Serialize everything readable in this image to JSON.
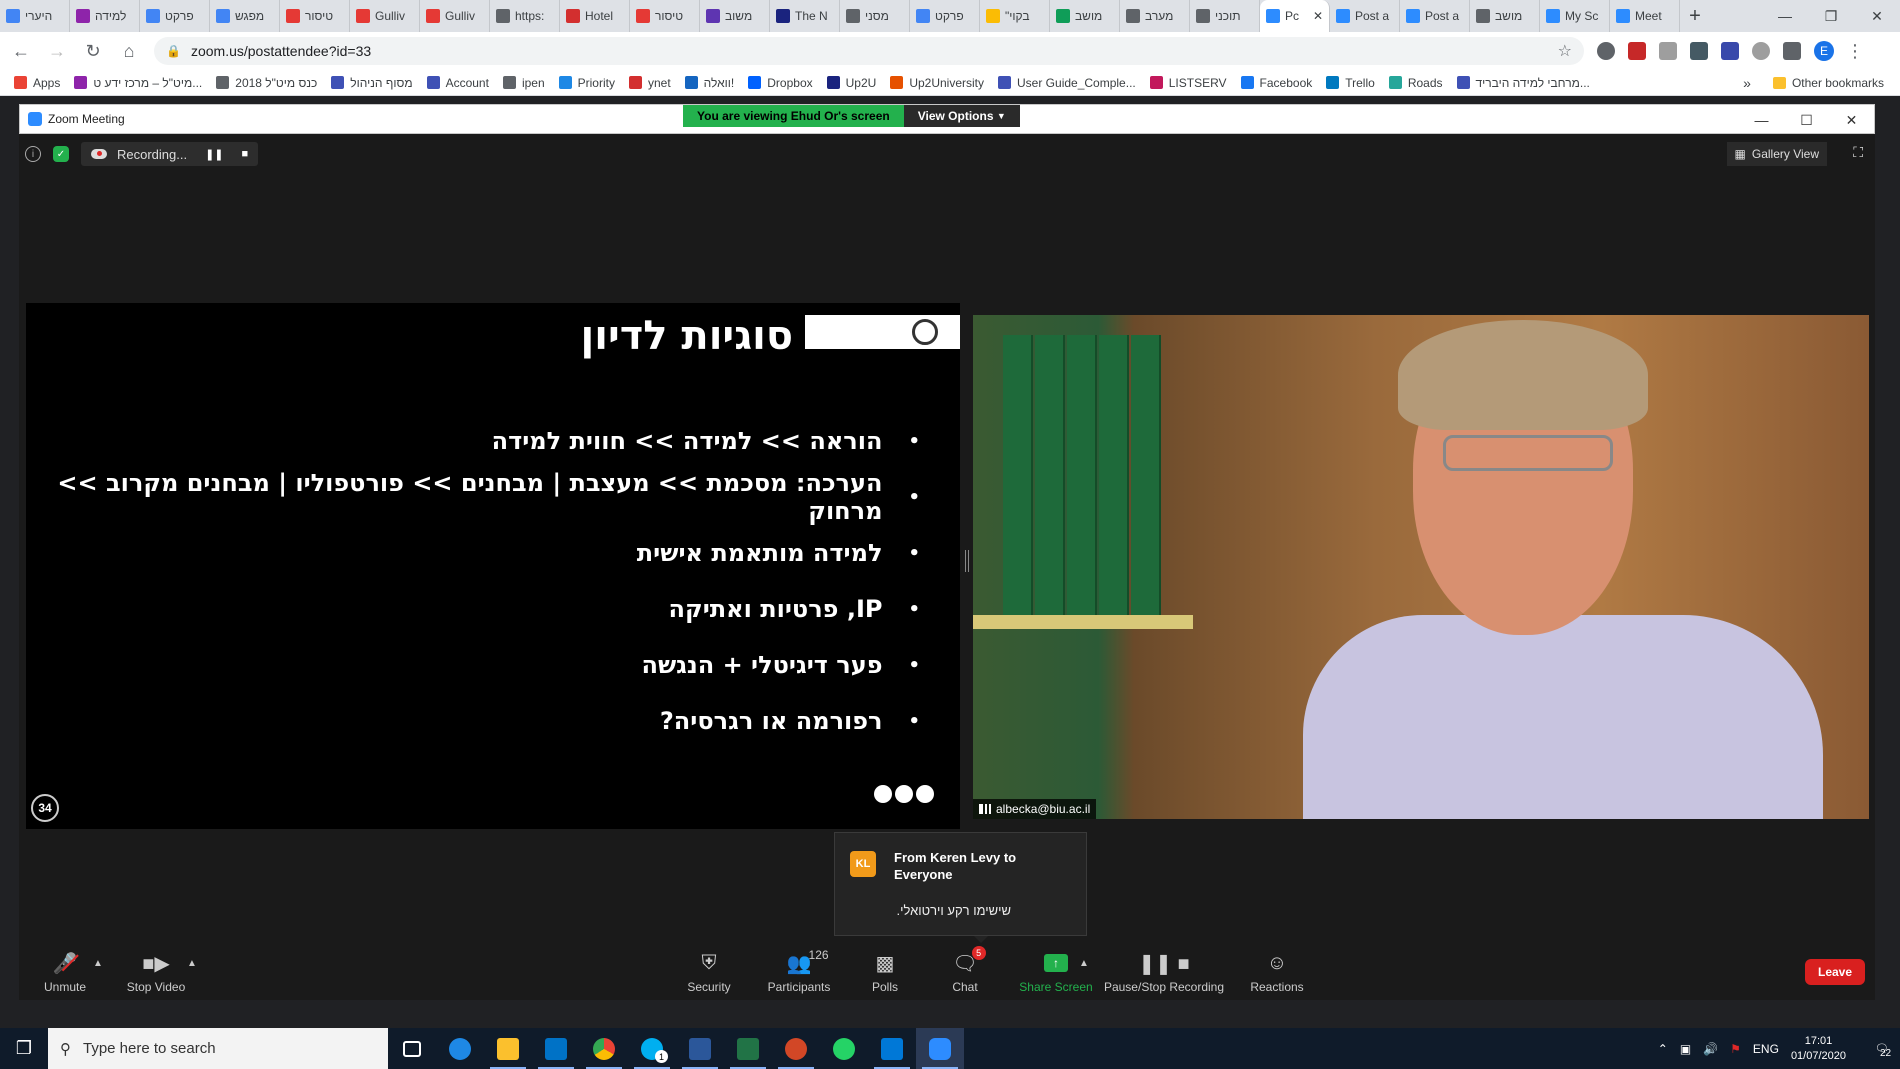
{
  "browser": {
    "tabs": [
      {
        "label": "היערי",
        "color": "#4285f4"
      },
      {
        "label": "למידה",
        "color": "#8e24aa"
      },
      {
        "label": "פרקט",
        "color": "#4285f4"
      },
      {
        "label": "מפגש",
        "color": "#4285f4"
      },
      {
        "label": "טיסור",
        "color": "#e53935"
      },
      {
        "label": "Gulliv",
        "color": "#e53935"
      },
      {
        "label": "Gulliv",
        "color": "#e53935"
      },
      {
        "label": "https:",
        "color": "#5f6368"
      },
      {
        "label": "Hotel",
        "color": "#d32f2f"
      },
      {
        "label": "טיסור",
        "color": "#e53935"
      },
      {
        "label": "משוב",
        "color": "#5e35b1"
      },
      {
        "label": "The N",
        "color": "#1a237e"
      },
      {
        "label": "מסני",
        "color": "#5f6368"
      },
      {
        "label": "פרקט",
        "color": "#4285f4"
      },
      {
        "label": "\"בקוי",
        "color": "#fbbc04"
      },
      {
        "label": "מושב",
        "color": "#0f9d58"
      },
      {
        "label": "מערב",
        "color": "#5f6368"
      },
      {
        "label": "תוכני",
        "color": "#5f6368"
      },
      {
        "label": "Pc",
        "color": "#2d8cff",
        "active": true
      },
      {
        "label": "Post a",
        "color": "#2d8cff"
      },
      {
        "label": "Post a",
        "color": "#2d8cff"
      },
      {
        "label": "מושב",
        "color": "#5f6368"
      },
      {
        "label": "My Sc",
        "color": "#2d8cff"
      },
      {
        "label": "Meet",
        "color": "#2d8cff"
      }
    ],
    "new_tab": "+",
    "url": "zoom.us/postattendee?id=33",
    "profile_initial": "E",
    "bookmarks": [
      {
        "label": "Apps",
        "color": "#ea4335"
      },
      {
        "label": "מיט\"ל – מרכז ידע ט...",
        "color": "#8e24aa"
      },
      {
        "label": "כנס מיט\"ל 2018",
        "color": "#5f6368"
      },
      {
        "label": "מסוף הניהול",
        "color": "#3f51b5"
      },
      {
        "label": "Account",
        "color": "#3f51b5"
      },
      {
        "label": "ipen",
        "color": "#5f6368"
      },
      {
        "label": "Priority",
        "color": "#1e88e5"
      },
      {
        "label": "ynet",
        "color": "#d32f2f"
      },
      {
        "label": "וואלה!",
        "color": "#1565c0"
      },
      {
        "label": "Dropbox",
        "color": "#0061fe"
      },
      {
        "label": "Up2U",
        "color": "#1a237e"
      },
      {
        "label": "Up2University",
        "color": "#e65100"
      },
      {
        "label": "User Guide_Comple...",
        "color": "#3f51b5"
      },
      {
        "label": "LISTSERV",
        "color": "#c2185b"
      },
      {
        "label": "Facebook",
        "color": "#1877f2"
      },
      {
        "label": "Trello",
        "color": "#0079bf"
      },
      {
        "label": "Roads",
        "color": "#26a69a"
      },
      {
        "label": "מרחבי למידה היבריד...",
        "color": "#3f51b5"
      }
    ],
    "bookmarks_more": "»",
    "other_bookmarks": "Other bookmarks"
  },
  "zoom": {
    "window_title": "Zoom Meeting",
    "viewing_banner": "You are viewing Ehud Or's screen",
    "view_options": "View Options",
    "recording_status": "Recording...",
    "gallery_view": "Gallery View",
    "slide": {
      "title": "סוגיות לדיון",
      "bullets": [
        "הוראה >> למידה >> חווית למידה",
        "הערכה: מסכמת >> מעצבת | מבחנים >> פורטפוליו | מבחנים מקרוב >> מרחוק",
        "למידה מותאמת אישית",
        "IP, פרטיות ואתיקה",
        "פער דיגיטלי + הנגשה",
        "רפורמה או רגרסיה?"
      ],
      "page_number": "34",
      "bullet_symbol": "•"
    },
    "video": {
      "participant_name": "albecka@biu.ac.il"
    },
    "chat_toast": {
      "avatar_initials": "KL",
      "from": "From Keren Levy to Everyone",
      "message": "שישימו רקע וירטואלי."
    },
    "toolbar": {
      "unmute": "Unmute",
      "stop_video": "Stop Video",
      "security": "Security",
      "participants": "Participants",
      "participants_count": "126",
      "polls": "Polls",
      "chat": "Chat",
      "chat_badge": "5",
      "share_screen": "Share Screen",
      "pause_stop_recording": "Pause/Stop Recording",
      "reactions": "Reactions",
      "leave": "Leave"
    }
  },
  "taskbar": {
    "search_placeholder": "Type here to search",
    "language": "ENG",
    "time": "17:01",
    "date": "01/07/2020",
    "notification_count": "22",
    "skype_badge": "1"
  },
  "colors": {
    "zoom_blue": "#2d8cff",
    "zoom_green": "#23b14d",
    "leave_red": "#d9201f",
    "toast_avatar": "#f19a1a"
  }
}
